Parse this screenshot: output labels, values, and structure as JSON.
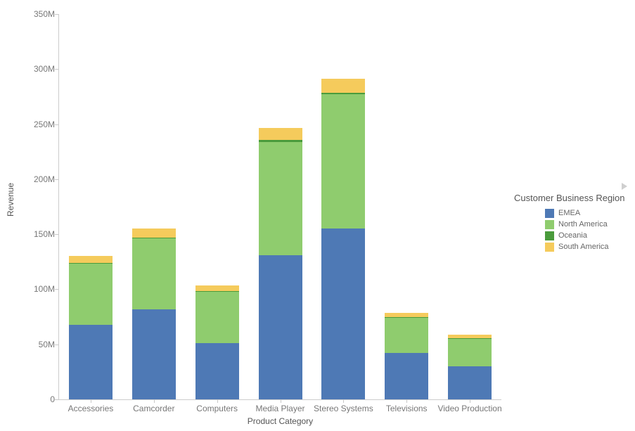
{
  "chart_data": {
    "type": "bar",
    "stacked": true,
    "title": "",
    "xlabel": "Product Category",
    "ylabel": "Revenue",
    "categories": [
      "Accessories",
      "Camcorder",
      "Computers",
      "Media Player",
      "Stereo Systems",
      "Televisions",
      "Video Production"
    ],
    "series": [
      {
        "name": "EMEA",
        "color": "#4e79b5",
        "values": [
          68,
          82,
          51,
          131,
          155,
          42,
          30
        ]
      },
      {
        "name": "North America",
        "color": "#8fcc6e",
        "values": [
          55,
          64,
          47,
          103,
          122,
          32,
          25
        ]
      },
      {
        "name": "Oceania",
        "color": "#4a9b3c",
        "values": [
          1,
          1,
          0.6,
          1.5,
          1.5,
          0.8,
          0.6
        ]
      },
      {
        "name": "South America",
        "color": "#f5cb5c",
        "values": [
          6,
          8,
          5,
          11,
          13,
          4,
          3
        ]
      }
    ],
    "ylim": [
      0,
      350
    ],
    "y_ticks": [
      0,
      50,
      100,
      150,
      200,
      250,
      300,
      350
    ],
    "y_tick_labels": [
      "0",
      "50M",
      "100M",
      "150M",
      "200M",
      "250M",
      "300M",
      "350M"
    ],
    "y_unit_suffix": "M",
    "grid": false,
    "legend_position": "right",
    "legend_title": "Customer Business Region"
  },
  "axes": {
    "y_title": "Revenue",
    "x_title": "Product Category"
  },
  "legend": {
    "title": "Customer Business Region",
    "expand_icon": "triangle-right-icon"
  }
}
